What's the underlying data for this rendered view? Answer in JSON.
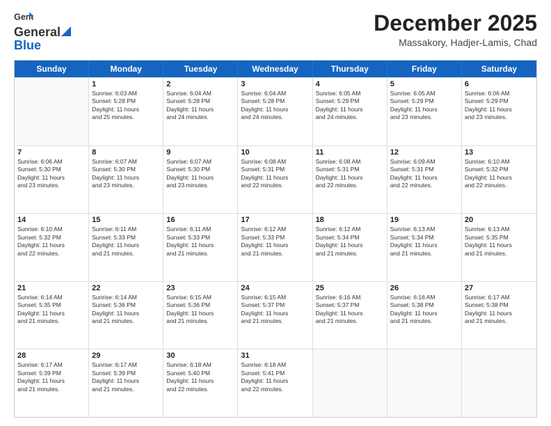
{
  "header": {
    "logo_line1": "General",
    "logo_line2": "Blue",
    "month_title": "December 2025",
    "location": "Massakory, Hadjer-Lamis, Chad"
  },
  "days_of_week": [
    "Sunday",
    "Monday",
    "Tuesday",
    "Wednesday",
    "Thursday",
    "Friday",
    "Saturday"
  ],
  "weeks": [
    [
      {
        "day": "",
        "info": ""
      },
      {
        "day": "1",
        "info": "Sunrise: 6:03 AM\nSunset: 5:28 PM\nDaylight: 11 hours\nand 25 minutes."
      },
      {
        "day": "2",
        "info": "Sunrise: 6:04 AM\nSunset: 5:28 PM\nDaylight: 11 hours\nand 24 minutes."
      },
      {
        "day": "3",
        "info": "Sunrise: 6:04 AM\nSunset: 5:28 PM\nDaylight: 11 hours\nand 24 minutes."
      },
      {
        "day": "4",
        "info": "Sunrise: 6:05 AM\nSunset: 5:29 PM\nDaylight: 11 hours\nand 24 minutes."
      },
      {
        "day": "5",
        "info": "Sunrise: 6:05 AM\nSunset: 5:29 PM\nDaylight: 11 hours\nand 23 minutes."
      },
      {
        "day": "6",
        "info": "Sunrise: 6:06 AM\nSunset: 5:29 PM\nDaylight: 11 hours\nand 23 minutes."
      }
    ],
    [
      {
        "day": "7",
        "info": "Sunrise: 6:06 AM\nSunset: 5:30 PM\nDaylight: 11 hours\nand 23 minutes."
      },
      {
        "day": "8",
        "info": "Sunrise: 6:07 AM\nSunset: 5:30 PM\nDaylight: 11 hours\nand 23 minutes."
      },
      {
        "day": "9",
        "info": "Sunrise: 6:07 AM\nSunset: 5:30 PM\nDaylight: 11 hours\nand 23 minutes."
      },
      {
        "day": "10",
        "info": "Sunrise: 6:08 AM\nSunset: 5:31 PM\nDaylight: 11 hours\nand 22 minutes."
      },
      {
        "day": "11",
        "info": "Sunrise: 6:08 AM\nSunset: 5:31 PM\nDaylight: 11 hours\nand 22 minutes."
      },
      {
        "day": "12",
        "info": "Sunrise: 6:09 AM\nSunset: 5:31 PM\nDaylight: 11 hours\nand 22 minutes."
      },
      {
        "day": "13",
        "info": "Sunrise: 6:10 AM\nSunset: 5:32 PM\nDaylight: 11 hours\nand 22 minutes."
      }
    ],
    [
      {
        "day": "14",
        "info": "Sunrise: 6:10 AM\nSunset: 5:32 PM\nDaylight: 11 hours\nand 22 minutes."
      },
      {
        "day": "15",
        "info": "Sunrise: 6:11 AM\nSunset: 5:33 PM\nDaylight: 11 hours\nand 21 minutes."
      },
      {
        "day": "16",
        "info": "Sunrise: 6:11 AM\nSunset: 5:33 PM\nDaylight: 11 hours\nand 21 minutes."
      },
      {
        "day": "17",
        "info": "Sunrise: 6:12 AM\nSunset: 5:33 PM\nDaylight: 11 hours\nand 21 minutes."
      },
      {
        "day": "18",
        "info": "Sunrise: 6:12 AM\nSunset: 5:34 PM\nDaylight: 11 hours\nand 21 minutes."
      },
      {
        "day": "19",
        "info": "Sunrise: 6:13 AM\nSunset: 5:34 PM\nDaylight: 11 hours\nand 21 minutes."
      },
      {
        "day": "20",
        "info": "Sunrise: 6:13 AM\nSunset: 5:35 PM\nDaylight: 11 hours\nand 21 minutes."
      }
    ],
    [
      {
        "day": "21",
        "info": "Sunrise: 6:14 AM\nSunset: 5:35 PM\nDaylight: 11 hours\nand 21 minutes."
      },
      {
        "day": "22",
        "info": "Sunrise: 6:14 AM\nSunset: 5:36 PM\nDaylight: 11 hours\nand 21 minutes."
      },
      {
        "day": "23",
        "info": "Sunrise: 6:15 AM\nSunset: 5:36 PM\nDaylight: 11 hours\nand 21 minutes."
      },
      {
        "day": "24",
        "info": "Sunrise: 6:15 AM\nSunset: 5:37 PM\nDaylight: 11 hours\nand 21 minutes."
      },
      {
        "day": "25",
        "info": "Sunrise: 6:16 AM\nSunset: 5:37 PM\nDaylight: 11 hours\nand 21 minutes."
      },
      {
        "day": "26",
        "info": "Sunrise: 6:16 AM\nSunset: 5:38 PM\nDaylight: 11 hours\nand 21 minutes."
      },
      {
        "day": "27",
        "info": "Sunrise: 6:17 AM\nSunset: 5:38 PM\nDaylight: 11 hours\nand 21 minutes."
      }
    ],
    [
      {
        "day": "28",
        "info": "Sunrise: 6:17 AM\nSunset: 5:39 PM\nDaylight: 11 hours\nand 21 minutes."
      },
      {
        "day": "29",
        "info": "Sunrise: 6:17 AM\nSunset: 5:39 PM\nDaylight: 11 hours\nand 21 minutes."
      },
      {
        "day": "30",
        "info": "Sunrise: 6:18 AM\nSunset: 5:40 PM\nDaylight: 11 hours\nand 22 minutes."
      },
      {
        "day": "31",
        "info": "Sunrise: 6:18 AM\nSunset: 5:41 PM\nDaylight: 11 hours\nand 22 minutes."
      },
      {
        "day": "",
        "info": ""
      },
      {
        "day": "",
        "info": ""
      },
      {
        "day": "",
        "info": ""
      }
    ]
  ]
}
